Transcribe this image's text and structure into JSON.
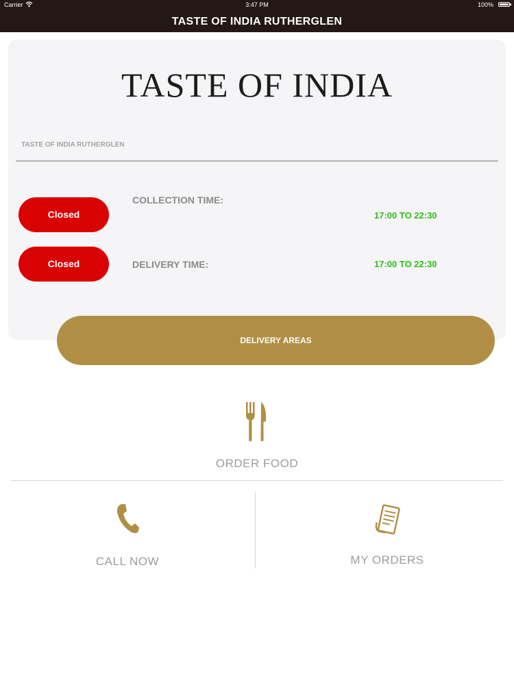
{
  "status_bar": {
    "carrier": "Carrier",
    "time": "3:47 PM",
    "battery": "100%"
  },
  "nav": {
    "title": "TASTE OF INDIA RUTHERGLEN"
  },
  "restaurant": {
    "brand": "TASTE OF INDIA",
    "name": "TASTE OF INDIA RUTHERGLEN"
  },
  "hours": {
    "collection": {
      "status": "Closed",
      "label": "COLLECTION TIME:",
      "value": "17:00 TO 22:30"
    },
    "delivery": {
      "status": "Closed",
      "label": "DELIVERY TIME:",
      "value": "17:00 TO 22:30"
    }
  },
  "delivery_areas_button": "DELIVERY AREAS",
  "actions": {
    "order_food": "ORDER FOOD",
    "call_now": "CALL NOW",
    "my_orders": "MY ORDERS"
  },
  "colors": {
    "bar": "#231814",
    "closed": "#d90104",
    "accent_gold": "#b08f45",
    "time_green": "#2fbf18"
  },
  "icons": {
    "order_food": "fork-knife-icon",
    "call_now": "phone-icon",
    "my_orders": "receipt-icon"
  }
}
